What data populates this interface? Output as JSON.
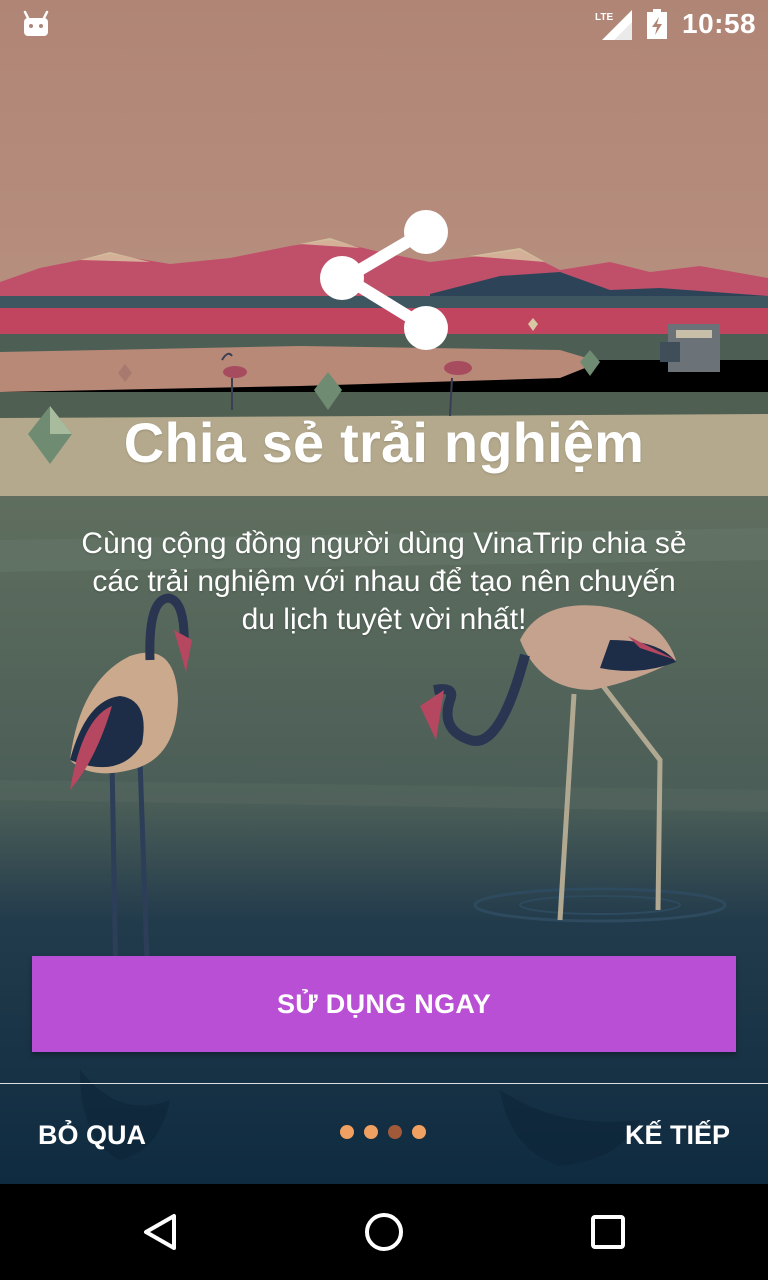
{
  "status_bar": {
    "time": "10:58",
    "network": "LTE",
    "icons": [
      "android-notification-icon",
      "lte-signal-icon",
      "battery-charging-icon"
    ]
  },
  "onboarding": {
    "icon": "share-icon",
    "title": "Chia sẻ trải nghiệm",
    "description": "Cùng cộng đồng người dùng VinaTrip chia sẻ các trải nghiệm với nhau để tạo nên chuyến du lịch tuyệt vời nhất!",
    "cta_label": "SỬ DỤNG NGAY",
    "skip_label": "BỎ QUA",
    "next_label": "KẾ TIẾP",
    "page_count": 4,
    "current_page_index": 2
  },
  "colors": {
    "accent": "#b94fd4",
    "dot_active": "#a05a3a",
    "dot_inactive": "#f0a060",
    "sky": "#b38878",
    "water_dark": "#10334a"
  },
  "nav_bar": {
    "icons": [
      "back-icon",
      "home-icon",
      "recents-icon"
    ]
  }
}
